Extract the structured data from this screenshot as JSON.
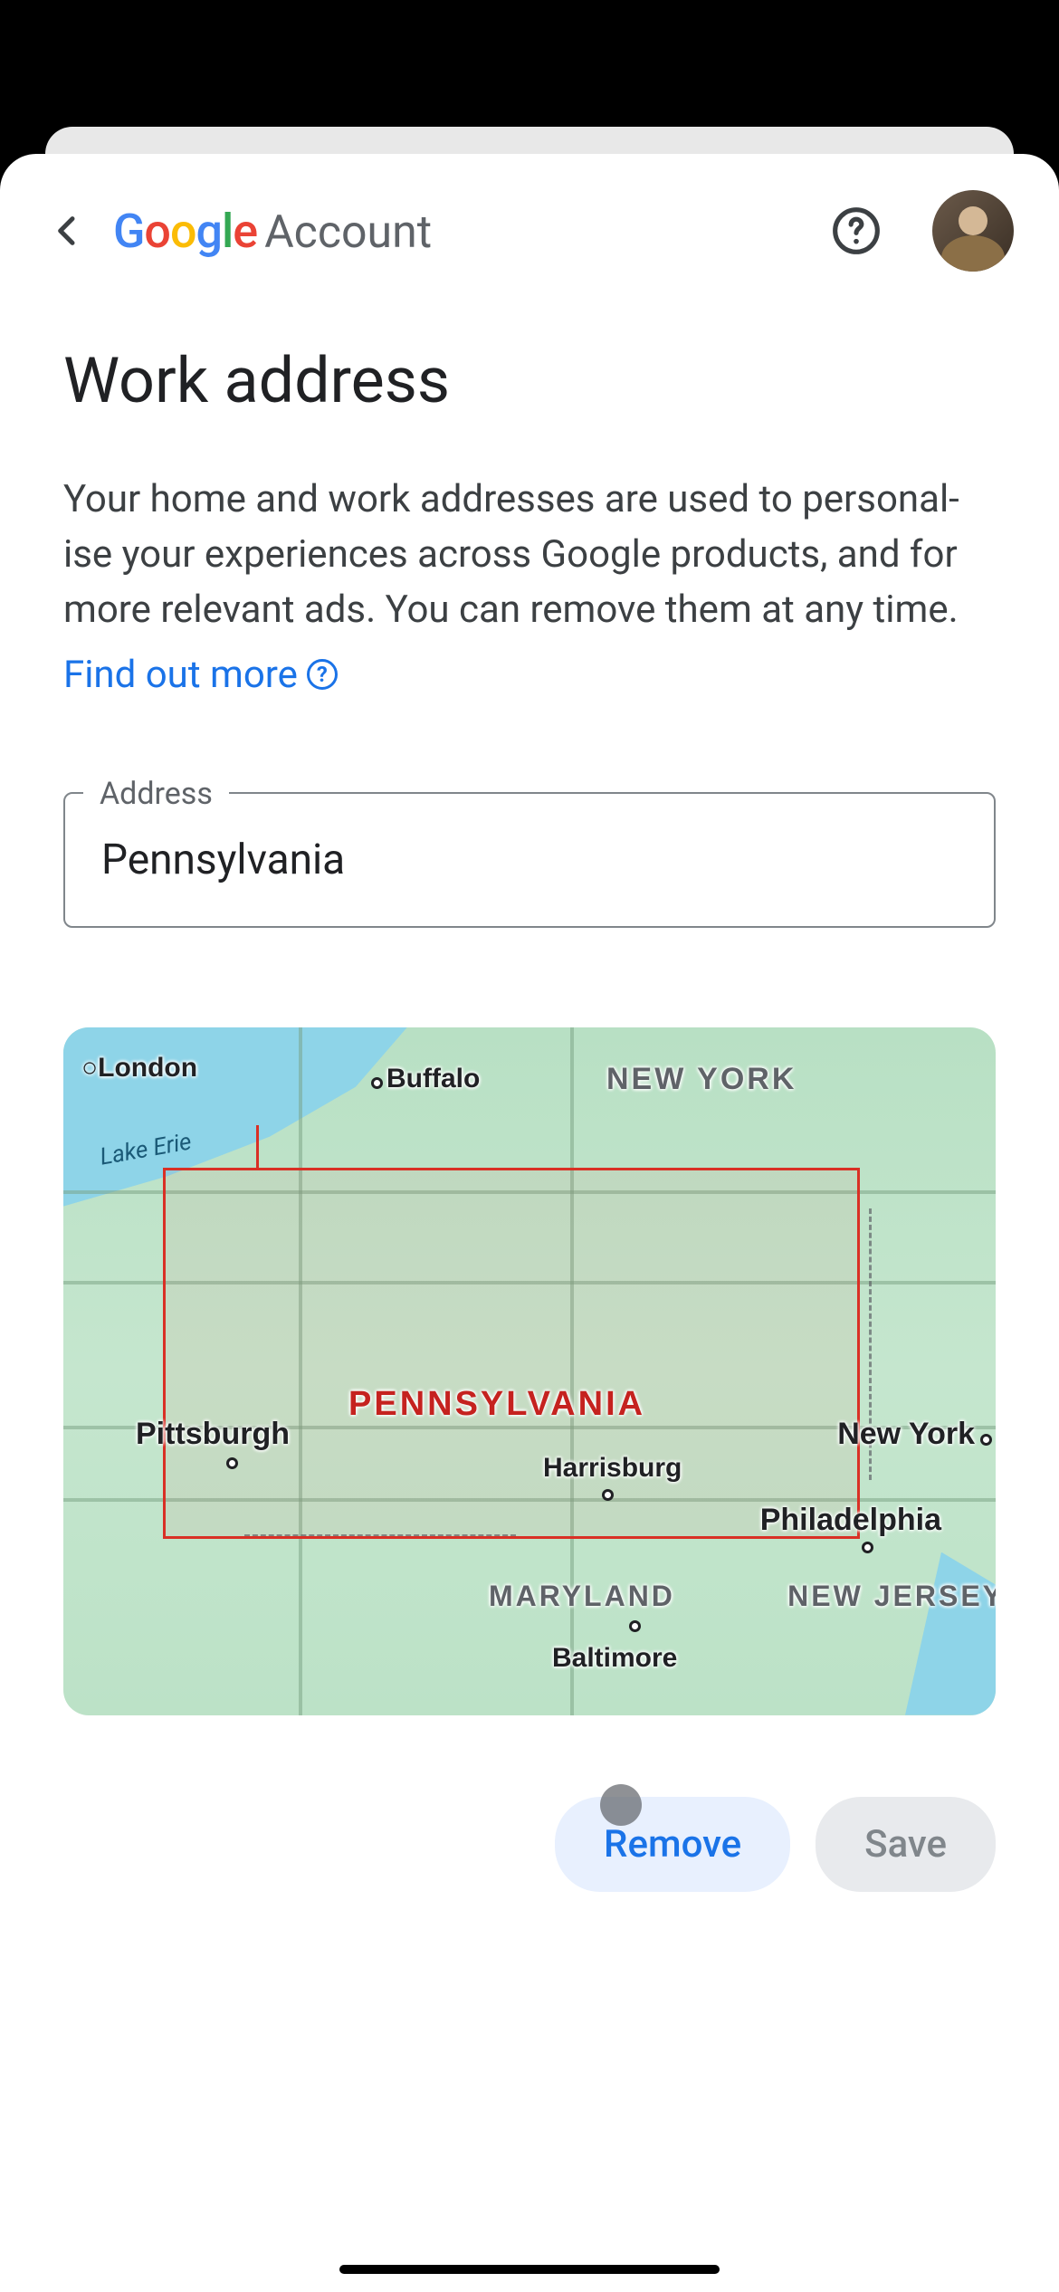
{
  "header": {
    "logo_text": "Google",
    "account_label": "Account"
  },
  "page": {
    "title": "Work address",
    "description": "Your home and work addresses are used to personal­ise your experiences across Google products, and for more relevant ads. You can remove them at any time.",
    "learn_more_label": "Find out more"
  },
  "address_field": {
    "label": "Address",
    "value": "Pennsylvania"
  },
  "map_labels": {
    "london": "London",
    "buffalo": "Buffalo",
    "new_york_state": "NEW YORK",
    "lake_erie": "Lake Erie",
    "pennsylvania": "PENNSYLVANIA",
    "pittsburgh": "Pittsburgh",
    "harrisburg": "Harrisburg",
    "new_york_city": "New York",
    "philadelphia": "Philadelphia",
    "maryland": "MARYLAND",
    "new_jersey": "NEW JERSEY",
    "baltimore": "Baltimore"
  },
  "actions": {
    "remove_label": "Remove",
    "save_label": "Save"
  }
}
